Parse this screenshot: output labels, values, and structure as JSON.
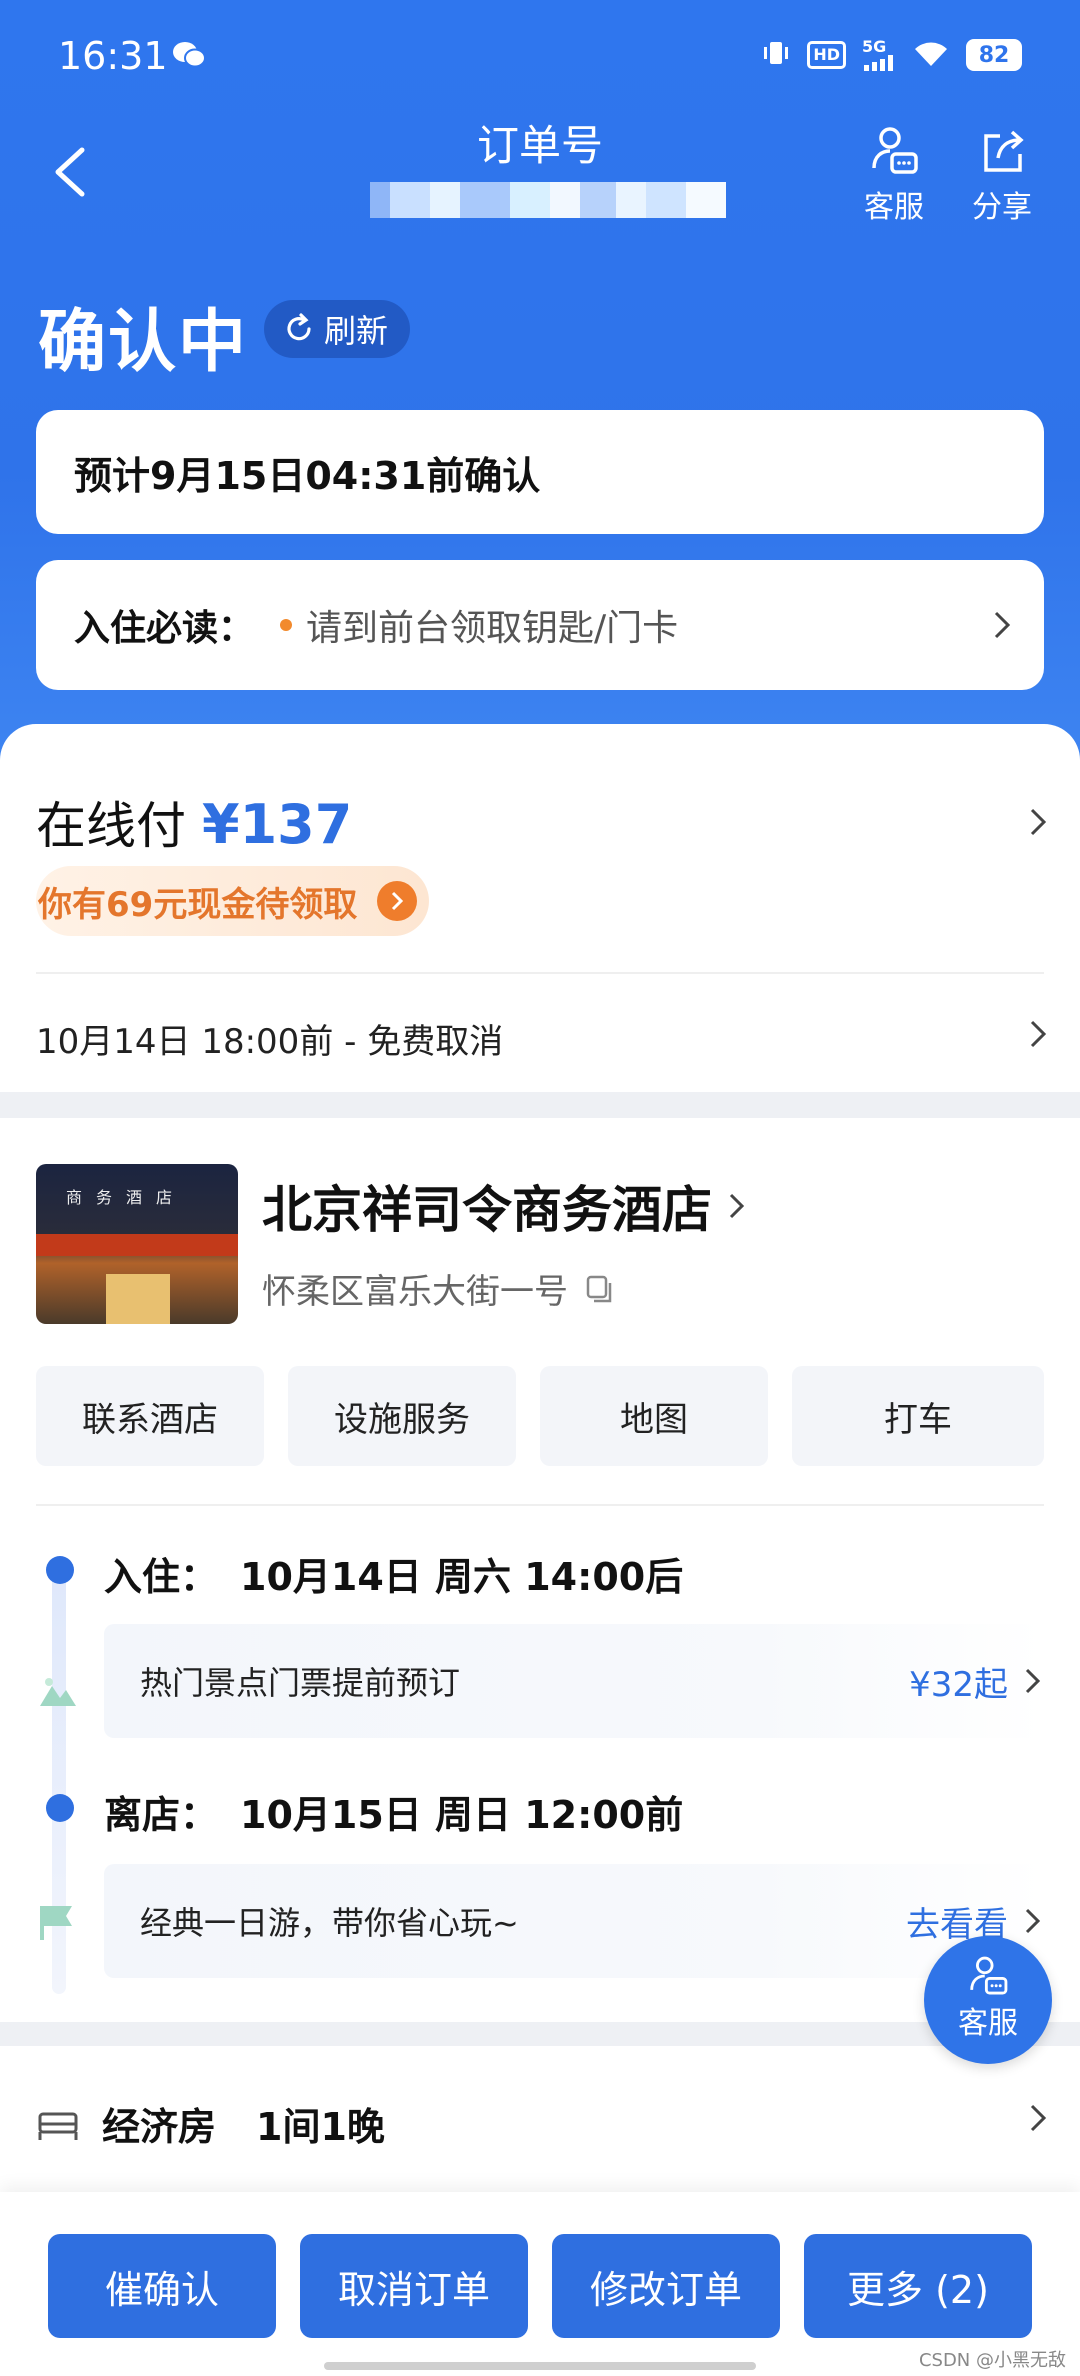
{
  "status_bar": {
    "time": "16:31",
    "hd": "HD",
    "network": "5G",
    "battery": "82"
  },
  "nav": {
    "title": "订单号",
    "service_label": "客服",
    "share_label": "分享"
  },
  "status": {
    "title": "确认中",
    "refresh_label": "刷新"
  },
  "confirm_note": "预计9月15日04:31前确认",
  "notice": {
    "label": "入住必读：",
    "text": "请到前台领取钥匙/门卡"
  },
  "payment": {
    "label": "在线付",
    "price": "¥137",
    "cash_promo": "你有69元现金待领取",
    "cancel_policy": "10月14日 18:00前 - 免费取消"
  },
  "hotel": {
    "name": "北京祥司令商务酒店",
    "address": "怀柔区富乐大街一号",
    "image_sign": "商务酒店",
    "actions": [
      "联系酒店",
      "设施服务",
      "地图",
      "打车"
    ]
  },
  "stay": {
    "checkin_label": "入住：",
    "checkin_value": "10月14日 周六 14:00后",
    "promo1_text": "热门景点门票提前预订",
    "promo1_price": "¥32起",
    "checkout_label": "离店：",
    "checkout_value": "10月15日 周日 12:00前",
    "promo2_text": "经典一日游，带你省心玩~",
    "promo2_link": "去看看"
  },
  "room": {
    "type": "经济房",
    "count": "1间1晚"
  },
  "float_service_label": "客服",
  "bottom_actions": [
    "催确认",
    "取消订单",
    "修改订单",
    "更多 (2)"
  ],
  "watermark": "CSDN @小黑无敌",
  "colors": {
    "primary": "#2f6fe0",
    "hero": "#2f76ee",
    "accent_orange": "#ef7d2c"
  }
}
